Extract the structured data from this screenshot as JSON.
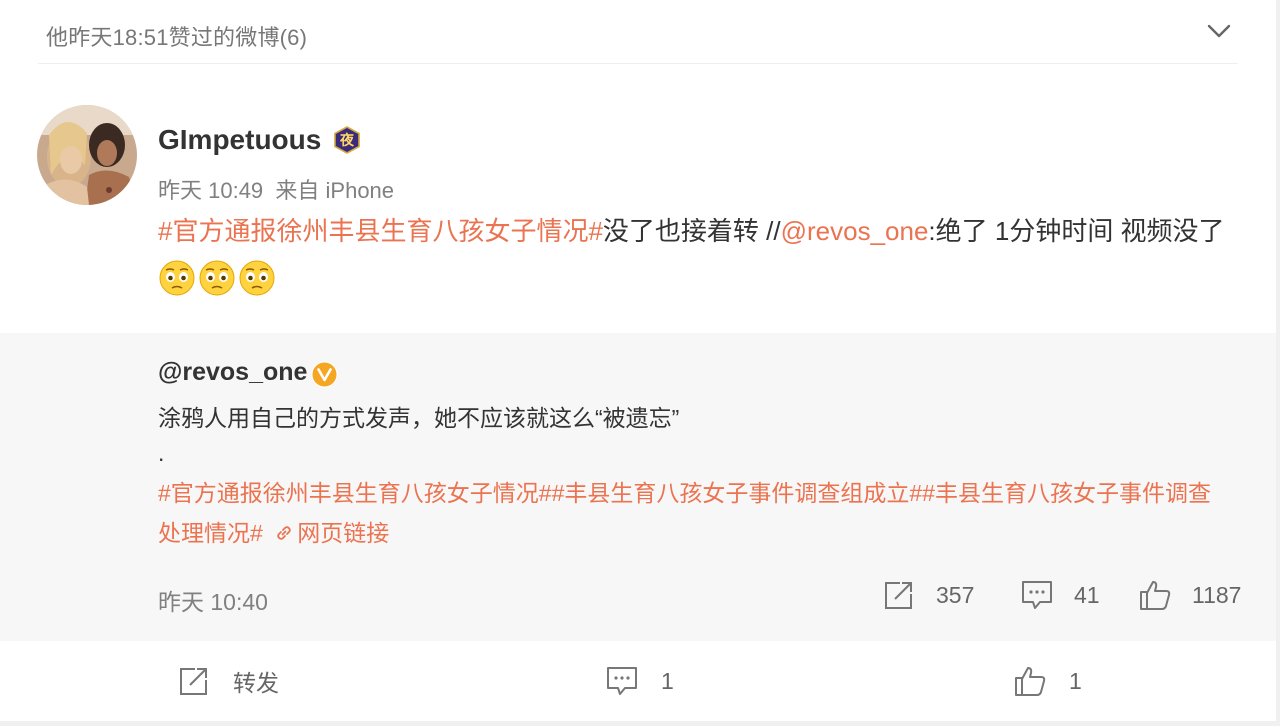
{
  "header": {
    "title": "他昨天18:51赞过的微博(6)"
  },
  "post": {
    "username": "GImpetuous",
    "badge_char": "夜",
    "time": "昨天 10:49",
    "source": "来自 iPhone",
    "text": {
      "tag": "#官方通报徐州丰县生育八孩女子情况#",
      "body1": "没了也接着转 //",
      "mention": "@revos_one",
      "body2": ":绝了 1分钟时间 视频没了"
    },
    "emoji_count": 3
  },
  "repost": {
    "username": "@revos_one",
    "verified": "V",
    "text1": "涂鸦人用自己的方式发声，她不应该就这么“被遗忘”",
    "dot": ".",
    "tags": "#官方通报徐州丰县生育八孩女子情况##丰县生育八孩女子事件调查组成立##丰县生育八孩女子事件调查处理情况#",
    "link_label": "网页链接",
    "time": "昨天 10:40",
    "reposts": "357",
    "comments": "41",
    "likes": "1187"
  },
  "bottom": {
    "repost_label": "转发",
    "comments": "1",
    "likes": "1"
  },
  "colors": {
    "accent": "#eb7350",
    "repost_bg": "#f7f7f7",
    "verified": "#f5a623"
  }
}
